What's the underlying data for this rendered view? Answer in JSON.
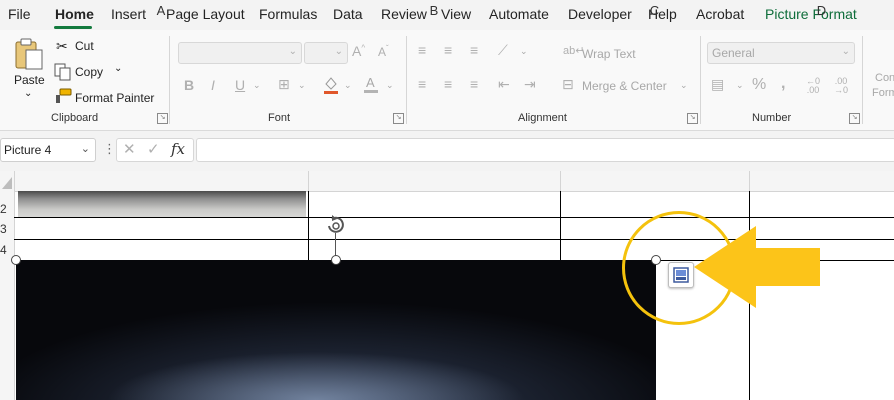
{
  "tabs": [
    "File",
    "Home",
    "Insert",
    "Page Layout",
    "Formulas",
    "Data",
    "Review",
    "View",
    "Automate",
    "Developer",
    "Help",
    "Acrobat",
    "Picture Format"
  ],
  "active_tab": "Home",
  "clipboard": {
    "paste": "Paste",
    "cut": "Cut",
    "copy": "Copy",
    "format_painter": "Format Painter",
    "label": "Clipboard"
  },
  "font": {
    "label": "Font"
  },
  "alignment": {
    "wrap_text": "Wrap Text",
    "merge_center": "Merge & Center",
    "label": "Alignment"
  },
  "number": {
    "format": "General",
    "label": "Number"
  },
  "styles_partial": {
    "line1": "Con",
    "line2": "Form"
  },
  "formula_bar": {
    "name_box": "Picture 4",
    "fx": "fx",
    "formula": ""
  },
  "columns": [
    "A",
    "B",
    "C",
    "D"
  ],
  "rows": [
    "2",
    "3",
    "4"
  ],
  "colors": {
    "accent": "#137a3e",
    "highlight": "#f4c20d",
    "picture_format": "#0e6d3a"
  },
  "icons": {
    "quick_action": "picture-layout-icon",
    "rotate": "rotate-handle-icon",
    "arrow": "yellow-pointer-arrow"
  }
}
